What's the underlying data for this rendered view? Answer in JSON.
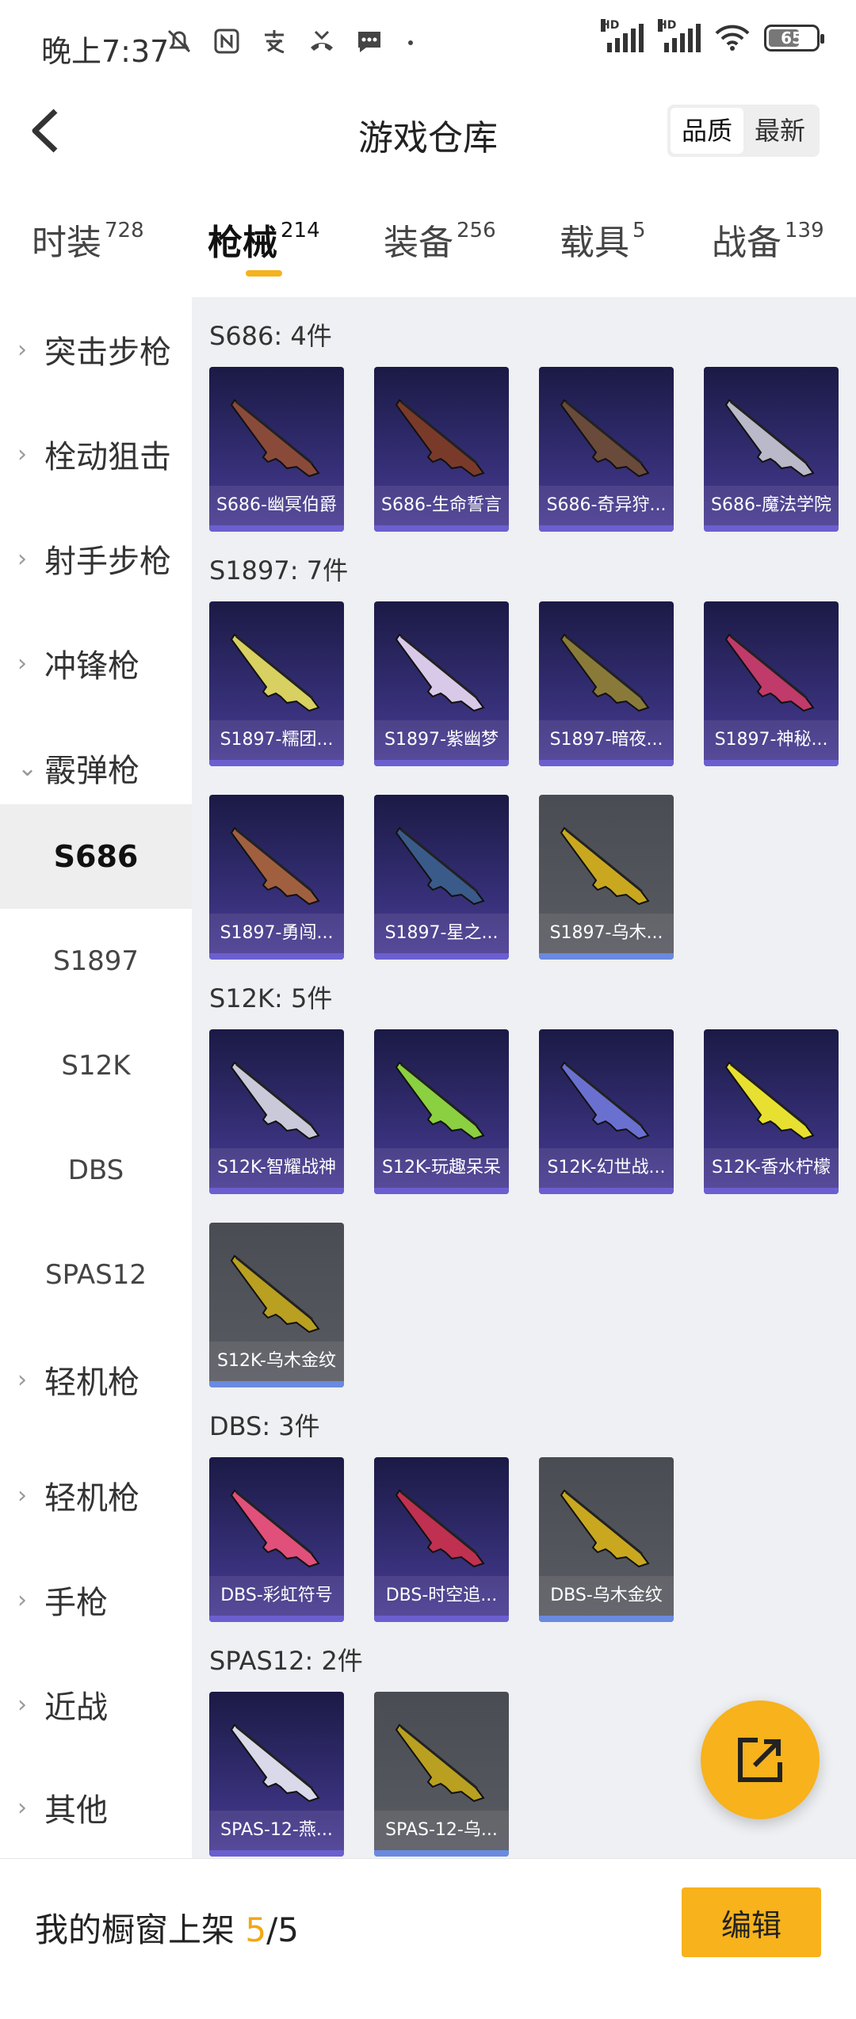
{
  "status_bar": {
    "time": "晚上7:37",
    "battery": "65",
    "hd1": "HD",
    "hd2": "HD"
  },
  "header": {
    "title": "游戏仓库",
    "sort_quality": "品质",
    "sort_newest": "最新"
  },
  "tabs": [
    {
      "label": "时装",
      "count": "728"
    },
    {
      "label": "枪械",
      "count": "214"
    },
    {
      "label": "装备",
      "count": "256"
    },
    {
      "label": "载具",
      "count": "5"
    },
    {
      "label": "战备",
      "count": "139"
    }
  ],
  "sidebar": [
    {
      "label": "突击步枪",
      "chevron": "›"
    },
    {
      "label": "栓动狙击",
      "chevron": "›"
    },
    {
      "label": "射手步枪",
      "chevron": "›"
    },
    {
      "label": "冲锋枪",
      "chevron": "›"
    },
    {
      "label": "霰弹枪",
      "chevron": "⌄"
    },
    {
      "label": "S686"
    },
    {
      "label": "S1897"
    },
    {
      "label": "S12K"
    },
    {
      "label": "DBS"
    },
    {
      "label": "SPAS12"
    },
    {
      "label": "轻机枪",
      "chevron": "›"
    },
    {
      "label": "轻机枪",
      "chevron": "›"
    },
    {
      "label": "手枪",
      "chevron": "›"
    },
    {
      "label": "近战",
      "chevron": "›"
    },
    {
      "label": "其他",
      "chevron": "›"
    }
  ],
  "sections": [
    {
      "title": "S686: 4件",
      "items": [
        "S686-幽冥伯爵",
        "S686-生命誓言",
        "S686-奇异狩...",
        "S686-魔法学院"
      ]
    },
    {
      "title": "S1897: 7件",
      "items": [
        "S1897-糯团...",
        "S1897-紫幽梦",
        "S1897-暗夜...",
        "S1897-神秘...",
        "S1897-勇闯...",
        "S1897-星之...",
        "S1897-乌木..."
      ]
    },
    {
      "title": "S12K: 5件",
      "items": [
        "S12K-智耀战神",
        "S12K-玩趣呆呆",
        "S12K-幻世战...",
        "S12K-香水柠檬",
        "S12K-乌木金纹"
      ]
    },
    {
      "title": "DBS: 3件",
      "items": [
        "DBS-彩虹符号",
        "DBS-时空追...",
        "DBS-乌木金纹"
      ]
    },
    {
      "title": "SPAS12: 2件",
      "items": [
        "SPAS-12-燕...",
        "SPAS-12-乌..."
      ]
    }
  ],
  "bottom": {
    "label": "我的橱窗上架",
    "current": "5",
    "sep_total": "/5",
    "edit_button": "编辑"
  },
  "colors": {
    "accent": "#f7b21c",
    "card_purple": "#332d72",
    "card_gray": "#55575e"
  }
}
